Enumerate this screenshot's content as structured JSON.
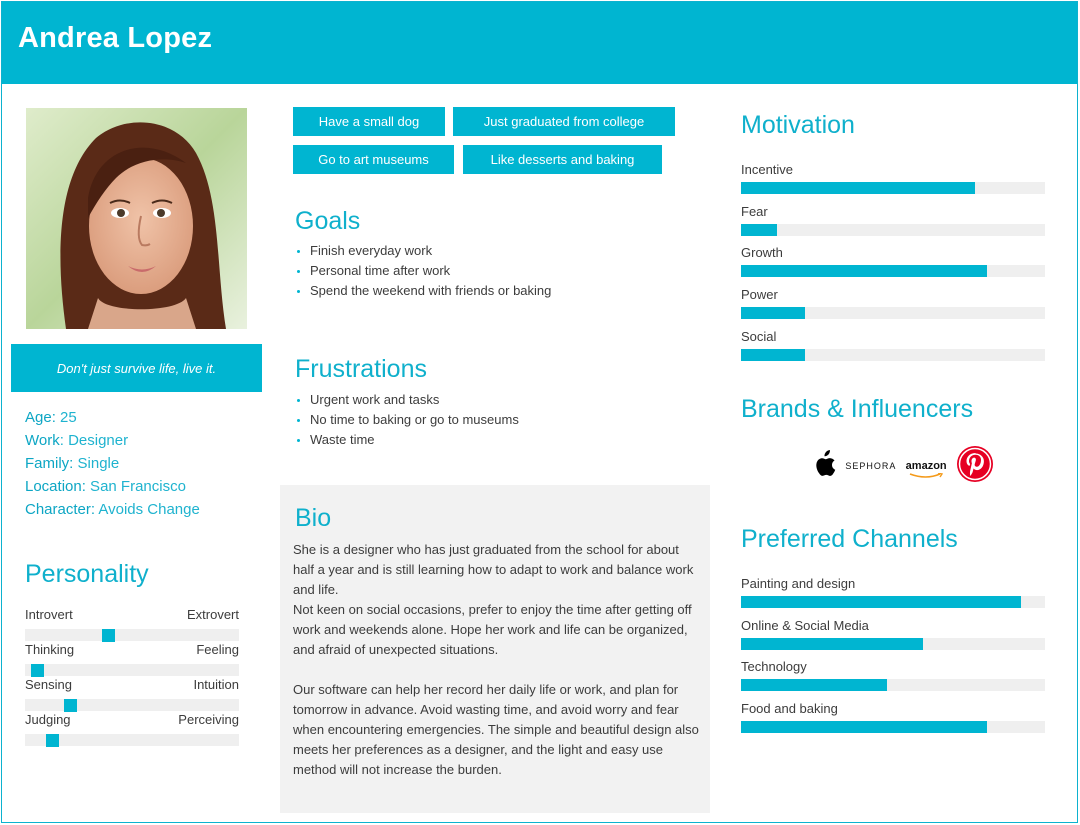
{
  "persona": {
    "name": "Andrea Lopez",
    "quote": "Don't just survive life, live it.",
    "facts": [
      {
        "key": "Age:",
        "value": " 25"
      },
      {
        "key": "Work",
        "value": ": Designer"
      },
      {
        "key": "Family:",
        "value": " Single"
      },
      {
        "key": "Location:",
        "value": " San Francisco"
      },
      {
        "key": "Character:",
        "value": " Avoids Change"
      }
    ]
  },
  "personality": {
    "title": "Personality",
    "traits": [
      {
        "left": "Introvert",
        "right": "Extrovert",
        "value": 0.36
      },
      {
        "left": "Thinking",
        "right": "Feeling",
        "value": 0.03
      },
      {
        "left": "Sensing",
        "right": "Intuition",
        "value": 0.18
      },
      {
        "left": "Judging",
        "right": "Perceiving",
        "value": 0.1
      }
    ]
  },
  "tags": [
    "Have a small dog",
    "Just graduated from college",
    "Go to art museums",
    "Like desserts and baking"
  ],
  "goals": {
    "title": "Goals",
    "items": [
      "Finish everyday work",
      "Personal time after work",
      "Spend the weekend with friends or baking"
    ]
  },
  "frustrations": {
    "title": "Frustrations",
    "items": [
      "Urgent work and tasks",
      "No time to baking or go to museums",
      "Waste time"
    ]
  },
  "bio": {
    "title": "Bio",
    "p1": "She is a designer who has just graduated from the school for about half a year and is still learning how to adapt to work and balance work and life.",
    "p2": "Not keen on social occasions, prefer to enjoy the time after getting off work and weekends alone. Hope her work and life can be organized, and afraid of unexpected situations.",
    "p3": "Our software can help her record her daily life or work, and plan for tomorrow in advance. Avoid wasting time, and avoid worry and fear when encountering emergencies. The simple and beautiful design also meets her preferences as a designer, and the light and easy use method will not increase the burden."
  },
  "motivation": {
    "title": "Motivation",
    "items": [
      {
        "label": "Incentive",
        "value": 0.77
      },
      {
        "label": "Fear",
        "value": 0.12
      },
      {
        "label": "Growth",
        "value": 0.81
      },
      {
        "label": "Power",
        "value": 0.21
      },
      {
        "label": "Social",
        "value": 0.21
      }
    ]
  },
  "brands": {
    "title": "Brands & Influencers",
    "logos": [
      "apple-logo",
      "sephora",
      "amazon",
      "pinterest-logo"
    ],
    "sephora_text": "SEPHORA",
    "amazon_text": "amazon",
    "pinterest_color": "#e60023"
  },
  "channels": {
    "title": "Preferred Channels",
    "items": [
      {
        "label": "Painting and design",
        "value": 0.92
      },
      {
        "label": "Online & Social Media",
        "value": 0.6
      },
      {
        "label": "Technology",
        "value": 0.48
      },
      {
        "label": "Food and baking",
        "value": 0.81
      }
    ]
  },
  "colors": {
    "accent": "#00b5d1",
    "track": "#efefef",
    "bio_bg": "#f2f2f2"
  }
}
